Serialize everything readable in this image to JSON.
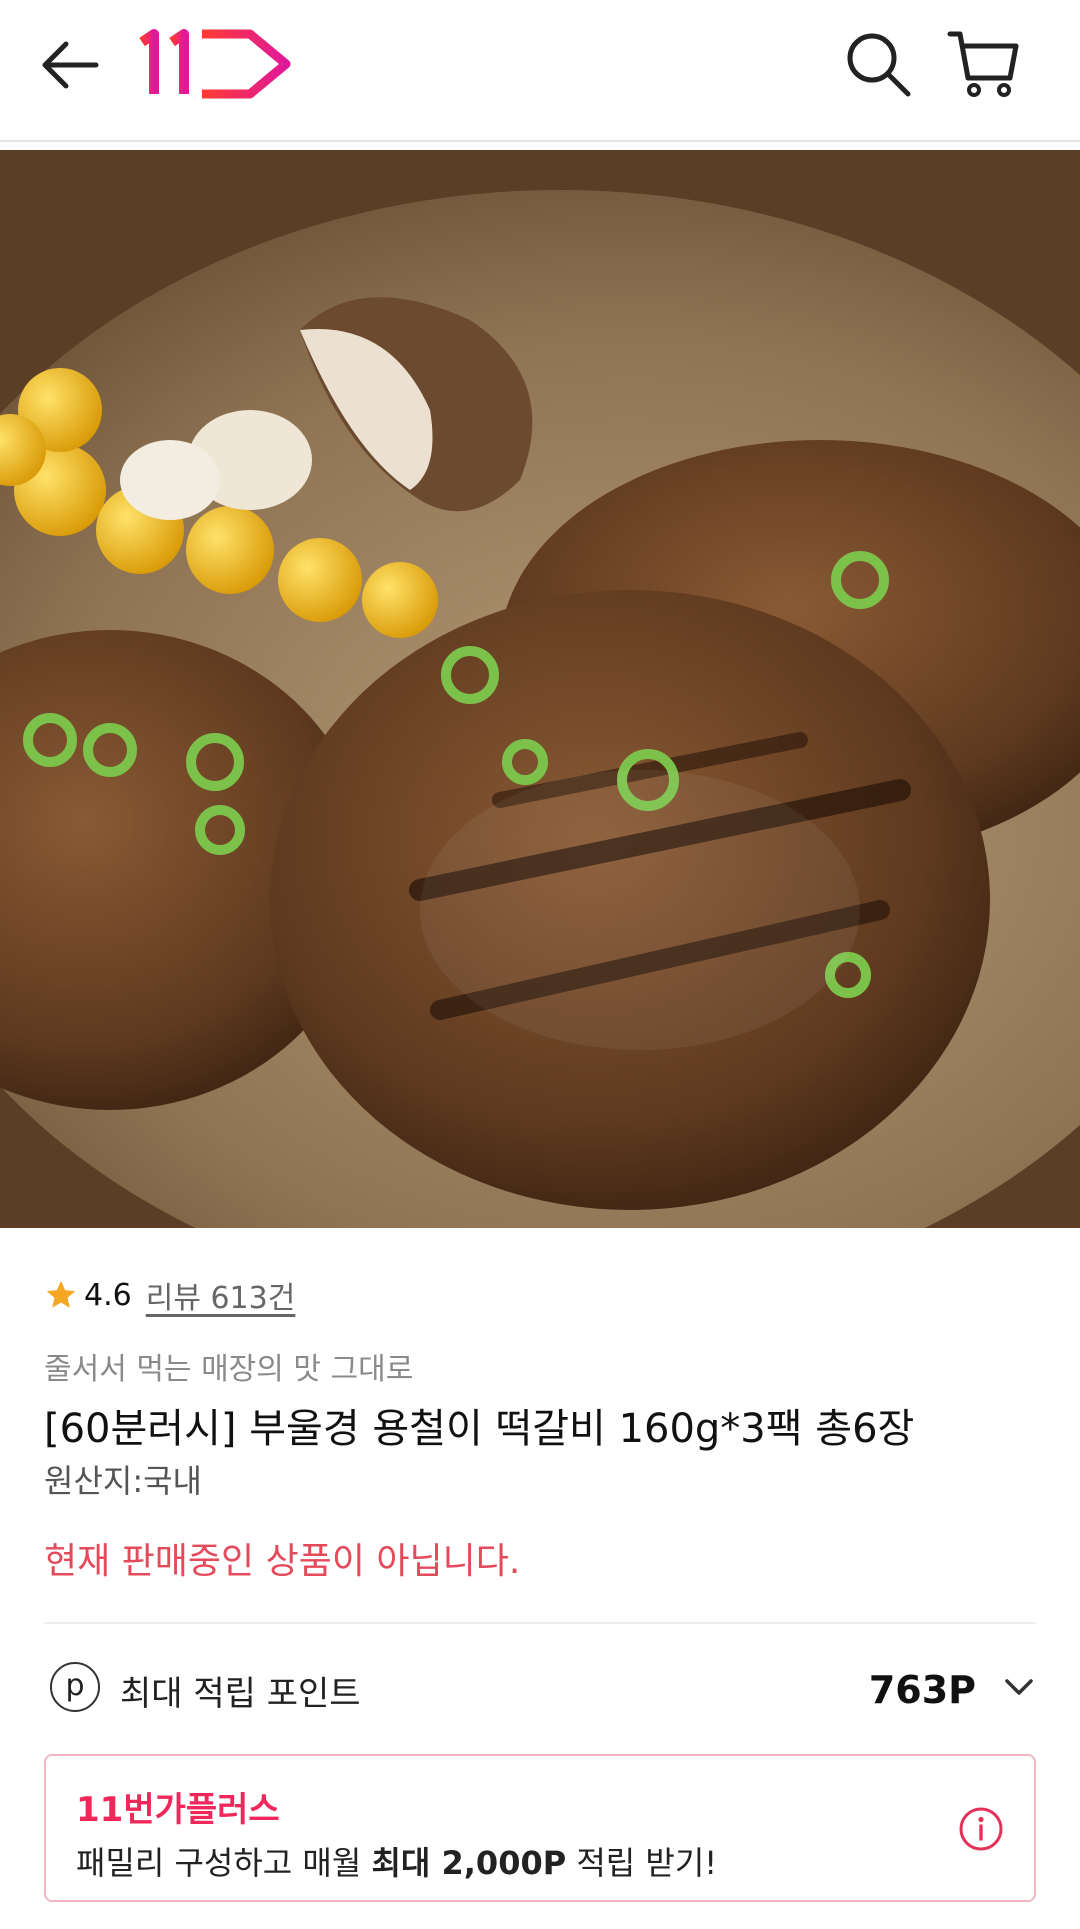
{
  "header": {
    "logo_text": "11",
    "back_icon": "arrow-left-icon",
    "search_icon": "search-icon",
    "cart_icon": "cart-icon"
  },
  "gallery": {
    "total_images": 4,
    "active_index": 0
  },
  "product": {
    "rating": "4.6",
    "review_label": "리뷰 613건",
    "subtitle": "줄서서 먹는 매장의 맛 그대로",
    "title": "[60분러시] 부울경 용철이 떡갈비 160g*3팩 총6장",
    "origin": "원산지:국내",
    "status": "현재 판매중인 상품이 아닙니다."
  },
  "points": {
    "icon_letter": "p",
    "label": "최대 적립 포인트",
    "value": "763P"
  },
  "plus": {
    "title": "11번가플러스",
    "desc_prefix": "패밀리 구성하고 매월 ",
    "desc_bold": "최대 2,000P",
    "desc_suffix": " 적립 받기!"
  },
  "colors": {
    "brand_red": "#f0275a",
    "status_red": "#e44a5a",
    "star": "#f5a623"
  }
}
